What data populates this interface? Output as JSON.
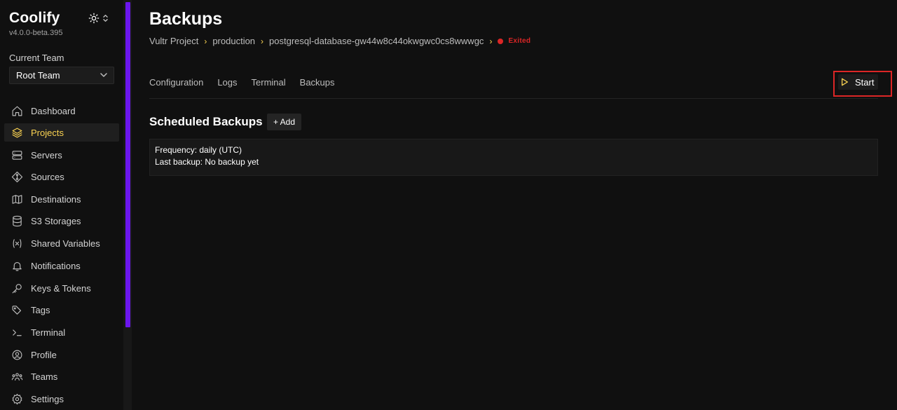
{
  "app": {
    "name": "Coolify",
    "version": "v4.0.0-beta.395",
    "accent": "#fcd452",
    "scroll_accent": "#6b16ed"
  },
  "team": {
    "label": "Current Team",
    "selected": "Root Team"
  },
  "sidebar": {
    "items": [
      {
        "label": "Dashboard",
        "icon": "home-icon",
        "active": false
      },
      {
        "label": "Projects",
        "icon": "layers-icon",
        "active": true
      },
      {
        "label": "Servers",
        "icon": "server-icon",
        "active": false
      },
      {
        "label": "Sources",
        "icon": "git-icon",
        "active": false
      },
      {
        "label": "Destinations",
        "icon": "map-icon",
        "active": false
      },
      {
        "label": "S3 Storages",
        "icon": "database-icon",
        "active": false
      },
      {
        "label": "Shared Variables",
        "icon": "variable-icon",
        "active": false
      },
      {
        "label": "Notifications",
        "icon": "bell-icon",
        "active": false
      },
      {
        "label": "Keys & Tokens",
        "icon": "key-icon",
        "active": false
      },
      {
        "label": "Tags",
        "icon": "tags-icon",
        "active": false
      },
      {
        "label": "Terminal",
        "icon": "terminal-icon",
        "active": false
      },
      {
        "label": "Profile",
        "icon": "user-circle-icon",
        "active": false
      },
      {
        "label": "Teams",
        "icon": "users-icon",
        "active": false
      },
      {
        "label": "Settings",
        "icon": "gear-icon",
        "active": false
      }
    ]
  },
  "page": {
    "title": "Backups",
    "breadcrumb": [
      "Vultr Project",
      "production",
      "postgresql-database-gw44w8c44okwgwc0cs8wwwgc"
    ],
    "status": "Exited",
    "status_color": "#dc2626"
  },
  "tabs": [
    "Configuration",
    "Logs",
    "Terminal",
    "Backups"
  ],
  "actions": {
    "start_label": "Start"
  },
  "backups": {
    "section_title": "Scheduled Backups",
    "add_label": "+ Add",
    "items": [
      {
        "frequency": "Frequency: daily (UTC)",
        "last_backup": "Last backup: No backup yet"
      }
    ]
  }
}
